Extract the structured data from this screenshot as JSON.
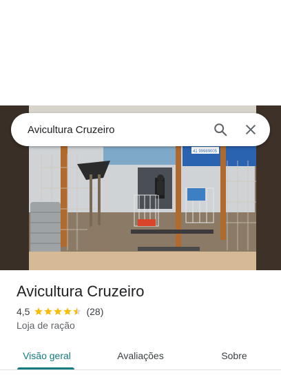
{
  "search": {
    "query": "Avicultura Cruzeiro",
    "search_icon": "search-icon",
    "close_icon": "close-icon"
  },
  "hero": {
    "photo": "storefront-photo",
    "sign_phone": "41 99989005"
  },
  "place": {
    "name": "Avicultura Cruzeiro",
    "rating": "4,5",
    "rating_value": 4.5,
    "review_count": "(28)",
    "category": "Loja de ração",
    "star_color": "#fbbc04"
  },
  "tabs": [
    {
      "label": "Visão geral",
      "active": true
    },
    {
      "label": "Avaliações",
      "active": false
    },
    {
      "label": "Sobre",
      "active": false
    }
  ],
  "colors": {
    "accent": "#137a7f",
    "text": "#202124"
  }
}
